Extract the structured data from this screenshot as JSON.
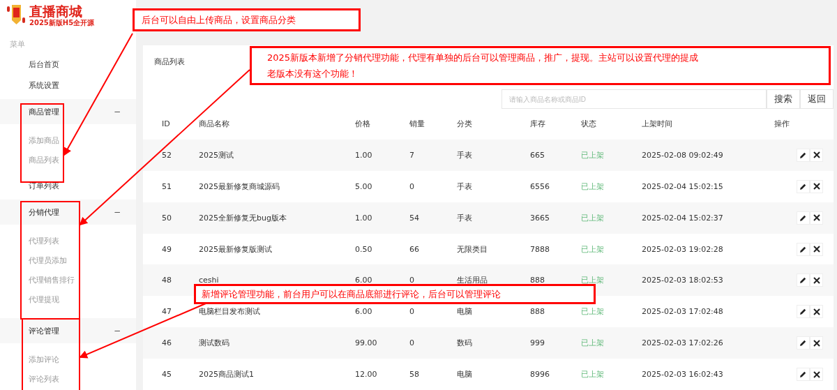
{
  "logo": {
    "title": "直播商城",
    "subtitle": "2025新版H5全开源"
  },
  "sidebar": {
    "heading": "菜单",
    "items": [
      {
        "kind": "link",
        "label": "后台首页"
      },
      {
        "kind": "link",
        "label": "系统设置"
      },
      {
        "kind": "group",
        "label": "商品管理",
        "toggle": "−",
        "expanded": true,
        "children": [
          {
            "label": "添加商品"
          },
          {
            "label": "商品列表"
          }
        ]
      },
      {
        "kind": "link",
        "label": "订单列表"
      },
      {
        "kind": "group",
        "label": "分销代理",
        "toggle": "−",
        "expanded": true,
        "children": [
          {
            "label": "代理列表"
          },
          {
            "label": "代理员添加"
          },
          {
            "label": "代理销售排行"
          },
          {
            "label": "代理提现"
          }
        ]
      },
      {
        "kind": "group",
        "label": "评论管理",
        "toggle": "−",
        "expanded": true,
        "children": [
          {
            "label": "添加评论"
          },
          {
            "label": "评论列表"
          }
        ]
      }
    ]
  },
  "panel": {
    "title": "商品列表",
    "search": {
      "placeholder": "请输入商品名称或商品ID"
    },
    "buttons": [
      "搜索",
      "返回"
    ]
  },
  "table": {
    "columns": [
      "ID",
      "商品名称",
      "价格",
      "销量",
      "分类",
      "库存",
      "状态",
      "上架时间",
      "操作"
    ],
    "rows": [
      {
        "id": "52",
        "name": "2025测试",
        "price": "1.00",
        "sales": "7",
        "category": "手表",
        "stock": "665",
        "status": "已上架",
        "time": "2025-02-08 09:02:49"
      },
      {
        "id": "51",
        "name": "2025最新修复商城源码",
        "price": "5.00",
        "sales": "0",
        "category": "手表",
        "stock": "6556",
        "status": "已上架",
        "time": "2025-02-04 15:02:15"
      },
      {
        "id": "50",
        "name": "2025全新修复无bug版本",
        "price": "1.00",
        "sales": "54",
        "category": "手表",
        "stock": "3665",
        "status": "已上架",
        "time": "2025-02-04 15:02:37"
      },
      {
        "id": "49",
        "name": "2025最新修复版测试",
        "price": "0.50",
        "sales": "66",
        "category": "无限类目",
        "stock": "7888",
        "status": "已上架",
        "time": "2025-02-03 19:02:28"
      },
      {
        "id": "48",
        "name": "ceshi",
        "price": "6.00",
        "sales": "0",
        "category": "生活用品",
        "stock": "888",
        "status": "已上架",
        "time": "2025-02-03 18:02:53"
      },
      {
        "id": "47",
        "name": "电脑栏目发布测试",
        "price": "6.00",
        "sales": "0",
        "category": "电脑",
        "stock": "888",
        "status": "已上架",
        "time": "2025-02-03 17:02:48"
      },
      {
        "id": "46",
        "name": "测试数码",
        "price": "99.00",
        "sales": "0",
        "category": "数码",
        "stock": "999",
        "status": "已上架",
        "time": "2025-02-03 17:02:26"
      },
      {
        "id": "45",
        "name": "2025商品测试1",
        "price": "12.00",
        "sales": "58",
        "category": "电脑",
        "stock": "8996",
        "status": "已上架",
        "time": "2025-02-03 16:02:43"
      }
    ]
  },
  "callouts": [
    {
      "lines": [
        "后台可以自由上传商品，设置商品分类"
      ]
    },
    {
      "lines": [
        "2025新版本新增了分销代理功能，代理有单独的后台可以管理商品，推广，提现。主站可以设置代理的提成",
        "老版本没有这个功能！"
      ]
    },
    {
      "lines": [
        "新增评论管理功能，前台用户可以在商品底部进行评论，后台可以管理评论"
      ]
    }
  ]
}
